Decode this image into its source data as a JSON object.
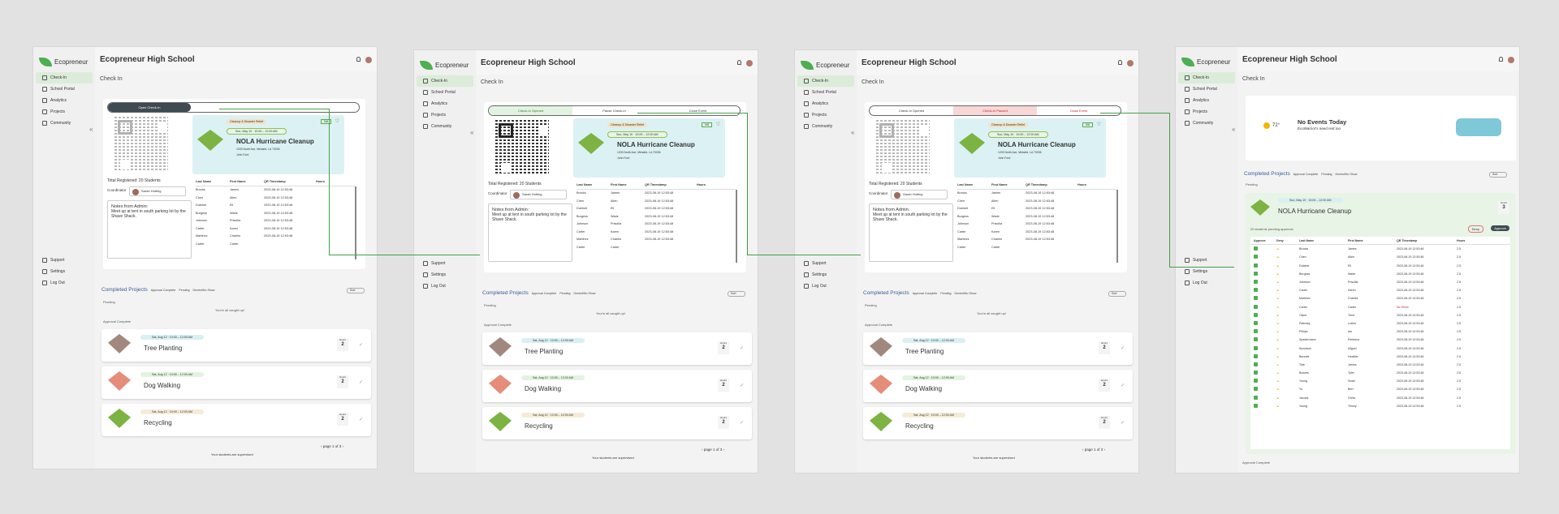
{
  "app": {
    "logo": "Ecopreneur",
    "school": "Ecopreneur High School",
    "page_title": "Check In"
  },
  "nav": {
    "items": [
      "Check-In",
      "School Portal",
      "Analytics",
      "Projects",
      "Community"
    ],
    "bottom": [
      "Support",
      "Settings",
      "Log Out"
    ]
  },
  "checkin": {
    "frame1_tabs": [
      "Open Check-In"
    ],
    "frame2_tabs": [
      "Check-In Opened",
      "Pause Check-In",
      "Close Event"
    ],
    "frame3_tabs": [
      "Check-In Opened",
      "Check-In Paused",
      "Close Event"
    ]
  },
  "event": {
    "badge": "Cleanup & Disaster Relief",
    "date": "Sun, May 10 · 10:00 – 12:00 AM",
    "title": "NOLA Hurricane Cleanup",
    "address": "1203 North Ave, Metairie, LA 70006",
    "host": "John Ford",
    "count": "5/8"
  },
  "registered": {
    "label": "Total Registered:",
    "value": "20 Students"
  },
  "coordinator": {
    "label": "Coordinator",
    "role": "Lead Coach",
    "name": "Sarah Hutting"
  },
  "notes": {
    "title": "Notes from Admin:",
    "text": "Meet up at tent in south parking lot by the Shave Shack."
  },
  "table": {
    "headers": [
      "Last Name",
      "First Name",
      "QR Timestamp",
      "Hours"
    ],
    "rows": [
      [
        "Brooks",
        "James",
        "2023-08-19 12:53:48",
        ""
      ],
      [
        "Chen",
        "Allen",
        "2023-08-19 12:53:48",
        ""
      ],
      [
        "Dubinet",
        "Eli",
        "2023-08-19 12:53:48",
        ""
      ],
      [
        "Burgess",
        "Wade",
        "2023-08-19 12:53:48",
        ""
      ],
      [
        "Johnson",
        "Priscilla",
        "2023-08-19 12:53:48",
        ""
      ],
      [
        "Carter",
        "Karen",
        "2023-08-19 12:53:48",
        ""
      ],
      [
        "Martinez",
        "Charles",
        "2023-08-19 12:53:48",
        ""
      ],
      [
        "Carter",
        "Carter",
        "",
        ""
      ]
    ],
    "pages": "8/1:2"
  },
  "completed": {
    "title": "Completed Projects",
    "chips": [
      "Approval Complete",
      "Pending",
      "Denied/No Show"
    ],
    "sort": "Sort",
    "pending": "Pending",
    "caught_up": "You're all caught up!",
    "approval_complete": "Approval Complete"
  },
  "projects": [
    {
      "date": "Sat, Aug 12 · 10:00 – 12:00 AM",
      "title": "Tree Planting",
      "hours_label": "Hours",
      "hours": "2"
    },
    {
      "date": "Sat, Aug 12 · 10:00 – 12:00 AM",
      "title": "Dog Walking",
      "hours_label": "Hours",
      "hours": "2"
    },
    {
      "date": "Sat, Aug 12 · 10:00 – 12:00 AM",
      "title": "Recycling",
      "hours_label": "Hours",
      "hours": "2"
    }
  ],
  "pager": "page 1 of 3",
  "footer": "Your students are supervised",
  "weather": {
    "temp": "72°",
    "title": "No Events Today",
    "subtitle": "EcoWarrior's need rest too"
  },
  "approval": {
    "count_label": "20 students pending approval",
    "deny": "Deny",
    "approve": "Approve",
    "hours": "3",
    "headers": [
      "Approve",
      "Deny",
      "Last Name",
      "First Name",
      "QR Timestamp",
      "Hours"
    ],
    "rows": [
      [
        "Brooks",
        "James"
      ],
      [
        "Chen",
        "Allen"
      ],
      [
        "Dubinet",
        "Eli"
      ],
      [
        "Burgess",
        "Wade"
      ],
      [
        "Johnson",
        "Priscilla"
      ],
      [
        "Carter",
        "Karen"
      ],
      [
        "Martinez",
        "Charles"
      ],
      [
        "Carter",
        "Carter"
      ],
      [
        "Olson",
        "Trent"
      ],
      [
        "Patinsky",
        "Luthor"
      ],
      [
        "Philips",
        "Ian"
      ],
      [
        "Spadermann",
        "Rebecca"
      ],
      [
        "Woodson",
        "Miguel"
      ],
      [
        "Bennett",
        "Heather"
      ],
      [
        "Tide",
        "James"
      ],
      [
        "Bowers",
        "Tyler"
      ],
      [
        "Young",
        "Susie"
      ],
      [
        "Yu",
        "Bert"
      ],
      [
        "Jacobs",
        "Greta"
      ],
      [
        "Young",
        "Timmy"
      ]
    ],
    "timestamp": "2023-08-19 12:53:48",
    "no_show": "No Show",
    "row_hours": "2.5"
  },
  "colors": {
    "accent": "#4caf50",
    "arrow": "#43a047",
    "event_bg": "#dcf1f3"
  }
}
